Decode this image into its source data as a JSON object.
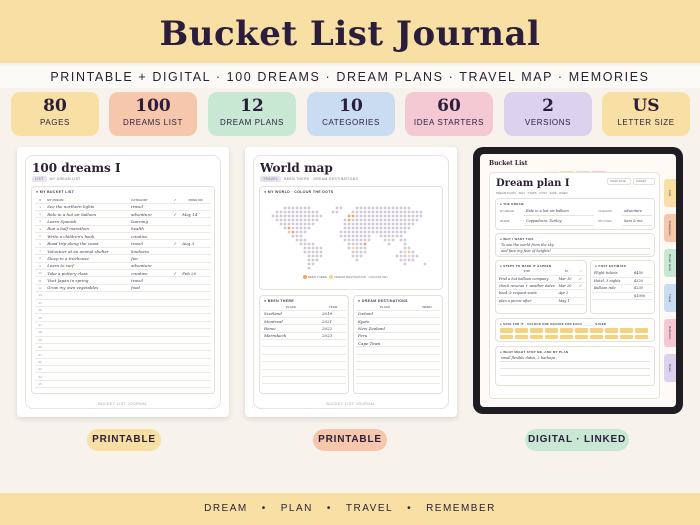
{
  "header": {
    "title": "Bucket List Journal",
    "subtitle": "PRINTABLE + DIGITAL · 100 DREAMS · DREAM PLANS · TRAVEL MAP · MEMORIES"
  },
  "stats": [
    {
      "number": "80",
      "label": "PAGES",
      "color": "#f8dfa4"
    },
    {
      "number": "100",
      "label": "DREAMS LIST",
      "color": "#f6c7ad"
    },
    {
      "number": "12",
      "label": "DREAM PLANS",
      "color": "#c8e8d4"
    },
    {
      "number": "10",
      "label": "CATEGORIES",
      "color": "#c9dcf2"
    },
    {
      "number": "60",
      "label": "IDEA STARTERS",
      "color": "#f4c9d4"
    },
    {
      "number": "2",
      "label": "VERSIONS",
      "color": "#ddd2ee"
    },
    {
      "number": "US",
      "label": "LETTER SIZE",
      "color": "#f8dfa4"
    }
  ],
  "page1": {
    "title": "100 dreams I",
    "tag1": "LIST",
    "tag2": "MY DREAM LIST",
    "section": "MY BUCKET LIST",
    "columns": [
      "#",
      "MY DREAM",
      "CATEGORY",
      "✓",
      "DONE ON"
    ],
    "rows": [
      {
        "n": "1",
        "dream": "See the northern lights",
        "cat": "travel",
        "chk": "",
        "done": ""
      },
      {
        "n": "2",
        "dream": "Ride in a hot air balloon",
        "cat": "adventure",
        "chk": "✓",
        "done": "May 14"
      },
      {
        "n": "3",
        "dream": "Learn Spanish",
        "cat": "learning",
        "chk": "",
        "done": ""
      },
      {
        "n": "4",
        "dream": "Run a half marathon",
        "cat": "health",
        "chk": "",
        "done": ""
      },
      {
        "n": "5",
        "dream": "Write a children's book",
        "cat": "creative",
        "chk": "",
        "done": ""
      },
      {
        "n": "6",
        "dream": "Road trip along the coast",
        "cat": "travel",
        "chk": "✓",
        "done": "Aug 3"
      },
      {
        "n": "7",
        "dream": "Volunteer at an animal shelter",
        "cat": "kindness",
        "chk": "",
        "done": ""
      },
      {
        "n": "8",
        "dream": "Sleep in a treehouse",
        "cat": "fun",
        "chk": "",
        "done": ""
      },
      {
        "n": "9",
        "dream": "Learn to surf",
        "cat": "adventure",
        "chk": "",
        "done": ""
      },
      {
        "n": "10",
        "dream": "Take a pottery class",
        "cat": "creative",
        "chk": "✓",
        "done": "Feb 20"
      },
      {
        "n": "11",
        "dream": "Visit Japan in spring",
        "cat": "travel",
        "chk": "",
        "done": ""
      },
      {
        "n": "12",
        "dream": "Grow my own vegetables",
        "cat": "food",
        "chk": "",
        "done": ""
      },
      {
        "n": "13",
        "dream": "",
        "cat": "",
        "chk": "",
        "done": ""
      },
      {
        "n": "14",
        "dream": "",
        "cat": "",
        "chk": "",
        "done": ""
      },
      {
        "n": "15",
        "dream": "",
        "cat": "",
        "chk": "",
        "done": ""
      },
      {
        "n": "16",
        "dream": "",
        "cat": "",
        "chk": "",
        "done": ""
      },
      {
        "n": "17",
        "dream": "",
        "cat": "",
        "chk": "",
        "done": ""
      },
      {
        "n": "18",
        "dream": "",
        "cat": "",
        "chk": "",
        "done": ""
      },
      {
        "n": "19",
        "dream": "",
        "cat": "",
        "chk": "",
        "done": ""
      },
      {
        "n": "20",
        "dream": "",
        "cat": "",
        "chk": "",
        "done": ""
      },
      {
        "n": "21",
        "dream": "",
        "cat": "",
        "chk": "",
        "done": ""
      },
      {
        "n": "22",
        "dream": "",
        "cat": "",
        "chk": "",
        "done": ""
      },
      {
        "n": "23",
        "dream": "",
        "cat": "",
        "chk": "",
        "done": ""
      },
      {
        "n": "24",
        "dream": "",
        "cat": "",
        "chk": "",
        "done": ""
      },
      {
        "n": "25",
        "dream": "",
        "cat": "",
        "chk": "",
        "done": ""
      }
    ],
    "footer": "BUCKET LIST JOURNAL"
  },
  "page2": {
    "title": "World map",
    "tag1": "TRAVEL",
    "tag2": "BEEN THERE · DREAM DESTINATIONS",
    "section_map": "MY WORLD · COLOUR THE DOTS",
    "legend": [
      "BEEN THERE",
      "DREAM DESTINATION",
      "COLOUR KEY"
    ],
    "been_there_title": "BEEN THERE",
    "been_cols": [
      "PLACE",
      "YEAR"
    ],
    "been_rows": [
      {
        "place": "Scotland",
        "year": "2019"
      },
      {
        "place": "Montreal",
        "year": "2021"
      },
      {
        "place": "Rome",
        "year": "2022"
      },
      {
        "place": "Marrakech",
        "year": "2023"
      }
    ],
    "dream_title": "DREAM DESTINATIONS",
    "dream_cols": [
      "PLACE",
      "WHEN"
    ],
    "dream_rows": [
      "Iceland",
      "Kyoto",
      "New Zealand",
      "Peru",
      "Cape Town"
    ],
    "footer": "BUCKET LIST JOURNAL"
  },
  "tablet": {
    "brand": "Bucket List",
    "top_tabs": [
      {
        "label": "HOME",
        "color": "#f3efe8"
      },
      {
        "label": "LIST",
        "color": "#f8dfa4"
      },
      {
        "label": "PLANS",
        "color": "#c8e8d4"
      },
      {
        "label": "MAP",
        "color": "#f4c9d4"
      }
    ],
    "side_tabs": [
      {
        "label": "Lists",
        "color": "#f8dfa4"
      },
      {
        "label": "Categories",
        "color": "#f6c7ad"
      },
      {
        "label": "Dream plans",
        "color": "#c8e8d4"
      },
      {
        "label": "Travel",
        "color": "#c9dcf2"
      },
      {
        "label": "Reflection",
        "color": "#f4c9d4"
      },
      {
        "label": "Notes",
        "color": "#ddd2ee"
      }
    ],
    "plan_title": "Dream plan I",
    "plan_tags": "DREAM PLANS · WHY · STEPS · COST · SAVE · WHEN",
    "header_boxes": [
      "START DATE",
      "TARGET"
    ],
    "section_dream": "THE DREAM",
    "dream_fields": [
      {
        "label": "MY DREAM",
        "value": "Ride in a hot air balloon",
        "label2": "CATEGORY",
        "value2": "adventure"
      },
      {
        "label": "WHERE",
        "value": "Cappadocia, Turkey",
        "label2": "WITH WHO",
        "value2": "Sam & me"
      }
    ],
    "section_why": "WHY I WANT THIS",
    "why_lines": [
      "To see the world from the sky",
      "and face my fear of heights!"
    ],
    "section_steps": "STEPS TO MAKE IT HAPPEN",
    "steps_cols": [
      "STEP",
      "BY",
      "✓"
    ],
    "steps": [
      {
        "step": "Find a hot balloon company",
        "by": "Mar 10",
        "chk": "✓"
      },
      {
        "step": "check reviews + weather dates",
        "by": "Mar 20",
        "chk": "✓"
      },
      {
        "step": "book & request seats",
        "by": "Apr 2",
        "chk": ""
      },
      {
        "step": "plan a picnic after",
        "by": "May 1",
        "chk": ""
      }
    ],
    "section_cost": "COST ESTIMATE",
    "costs": [
      {
        "item": "Flight tickets",
        "amount": "$450"
      },
      {
        "item": "Hotel, 3 nights",
        "amount": "$320"
      },
      {
        "item": "Balloon ride",
        "amount": "$230"
      },
      {
        "item": "",
        "amount": "$1000"
      }
    ],
    "section_save": "SAVE FOR IT · COLOUR ONE SQUARE FOR EACH ______ SAVED",
    "section_reflect": "WHAT MIGHT STOP ME, AND MY PLAN",
    "reflect_lines": [
      "small flexible dates, 2 backups"
    ]
  },
  "pills": [
    {
      "label": "PRINTABLE",
      "color": "#f8dfa4"
    },
    {
      "label": "PRINTABLE",
      "color": "#f6c7ad"
    },
    {
      "label": "DIGITAL · LINKED",
      "color": "#c8e8d4"
    }
  ],
  "footer_words": [
    "DREAM",
    "PLAN",
    "TRAVEL",
    "REMEMBER"
  ]
}
